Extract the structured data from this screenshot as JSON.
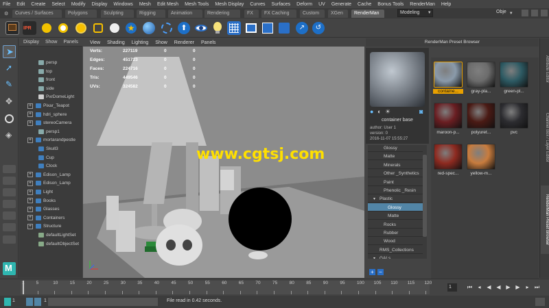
{
  "menubar": [
    "File",
    "Edit",
    "Create",
    "Select",
    "Modify",
    "Display",
    "Windows",
    "Mesh",
    "Edit Mesh",
    "Mesh Tools",
    "Mesh Display",
    "Curves",
    "Surfaces",
    "Deform",
    "UV",
    "Generate",
    "Cache",
    "Bonus Tools",
    "RenderMan",
    "Help"
  ],
  "shelf_tabs": [
    "Curves / Surfaces",
    "Polygons",
    "Sculpting",
    "Rigging",
    "Animation",
    "Rendering",
    "FX",
    "FX Caching",
    "Custom",
    "XGen",
    "RenderMan"
  ],
  "mode": "Modeling",
  "object_select": "Obje",
  "shelf_icon_badge": "IPR",
  "outliner": {
    "menu": [
      "Display",
      "Show",
      "Panels"
    ],
    "items": [
      "persp",
      "top",
      "front",
      "side",
      "PxrDomeLight",
      "Pixar_Teapot",
      "hdri_sphere",
      "stereoCamera",
      "persp1",
      "mortarandpestle",
      "Skull3",
      "Cup",
      "Clock",
      "Edison_Lamp",
      "Edison_Lamp",
      "Light",
      "Books",
      "Glasses",
      "Containers",
      "Structure",
      "defaultLightSet",
      "defaultObjectSet"
    ]
  },
  "viewport": {
    "menu": [
      "View",
      "Shading",
      "Lighting",
      "Show",
      "Renderer",
      "Panels"
    ],
    "hud": [
      {
        "label": "Verts:",
        "v1": "227119",
        "v2": "0",
        "v3": "0"
      },
      {
        "label": "Edges:",
        "v1": "451723",
        "v2": "0",
        "v3": "0"
      },
      {
        "label": "Faces:",
        "v1": "224716",
        "v2": "0",
        "v3": "0"
      },
      {
        "label": "Tris:",
        "v1": "449546",
        "v2": "0",
        "v3": "0"
      },
      {
        "label": "UVs:",
        "v1": "324582",
        "v2": "0",
        "v3": "0"
      }
    ],
    "watermark": "www.cgtsj.com"
  },
  "preset_browser": {
    "title": "RenderMan Preset Browser",
    "preview_name": "container base",
    "author": "author: User 1",
    "version": "version: 0",
    "date": "2016-11-07 15:55:27",
    "categories": [
      "Glossy",
      "Matte",
      "Minerals",
      "Other _Synthetics",
      "Paint",
      "Phenolic _Resin",
      "Plastic",
      "Glossy",
      "Matte",
      "Rocks",
      "Rubber",
      "Wood",
      "RMS_Collections",
      "GALs"
    ],
    "swatches": [
      {
        "label": "containe...",
        "color": "#8a9aaa"
      },
      {
        "label": "gray-pla...",
        "color": "#6c6c6c"
      },
      {
        "label": "green-pl...",
        "color": "#2d5a63"
      },
      {
        "label": "maroon-p...",
        "color": "#6a1e22"
      },
      {
        "label": "polyuret...",
        "color": "#4a1a14"
      },
      {
        "label": "pvc",
        "color": "#2c2c30"
      },
      {
        "label": "red-spec...",
        "color": "#8e2a20"
      },
      {
        "label": "yellow-m...",
        "color": "#c87c3e"
      }
    ]
  },
  "side_tabs": [
    "Attribute Editor",
    "Channel Box / Layer Editor",
    "RenderMan Preset Browser"
  ],
  "timeline": {
    "ticks": [
      "1",
      "5",
      "10",
      "15",
      "20",
      "25",
      "30",
      "35",
      "40",
      "45",
      "50",
      "55",
      "60",
      "65",
      "70",
      "75",
      "80",
      "85",
      "90",
      "95",
      "100",
      "105",
      "110",
      "115",
      "120"
    ],
    "current_frame": "1"
  },
  "range": {
    "start": "1",
    "end": "1"
  },
  "status": "File read in  0.42 seconds."
}
